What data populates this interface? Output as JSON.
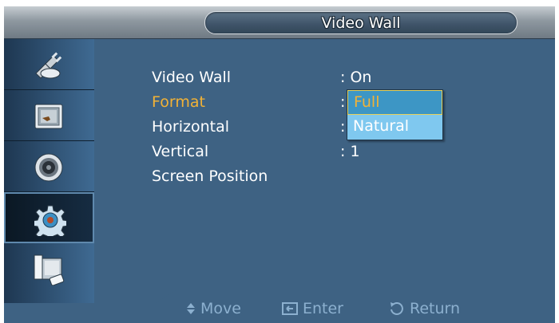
{
  "title": "Video Wall",
  "sidebar": {
    "items": [
      {
        "name": "input",
        "icon": "input-plug-icon"
      },
      {
        "name": "picture",
        "icon": "picture-icon"
      },
      {
        "name": "sound",
        "icon": "speaker-icon"
      },
      {
        "name": "setup",
        "icon": "gear-icon",
        "active": true
      },
      {
        "name": "multi-control",
        "icon": "display-remote-icon"
      }
    ]
  },
  "menu": {
    "rows": [
      {
        "label": "Video Wall",
        "value": ": On"
      },
      {
        "label": "Format",
        "value": ":"
      },
      {
        "label": "Horizontal",
        "value": ":"
      },
      {
        "label": "Vertical",
        "value": ": 1"
      },
      {
        "label": "Screen Position",
        "value": ""
      }
    ],
    "selected_row": "Format"
  },
  "dropdown": {
    "options": [
      "Full",
      "Natural"
    ],
    "selected": "Full"
  },
  "footer": {
    "move": "Move",
    "enter": "Enter",
    "return": "Return"
  },
  "colors": {
    "panel": "#3e6283",
    "highlight": "#f2b236",
    "dropdown": "#7fc8ef"
  }
}
